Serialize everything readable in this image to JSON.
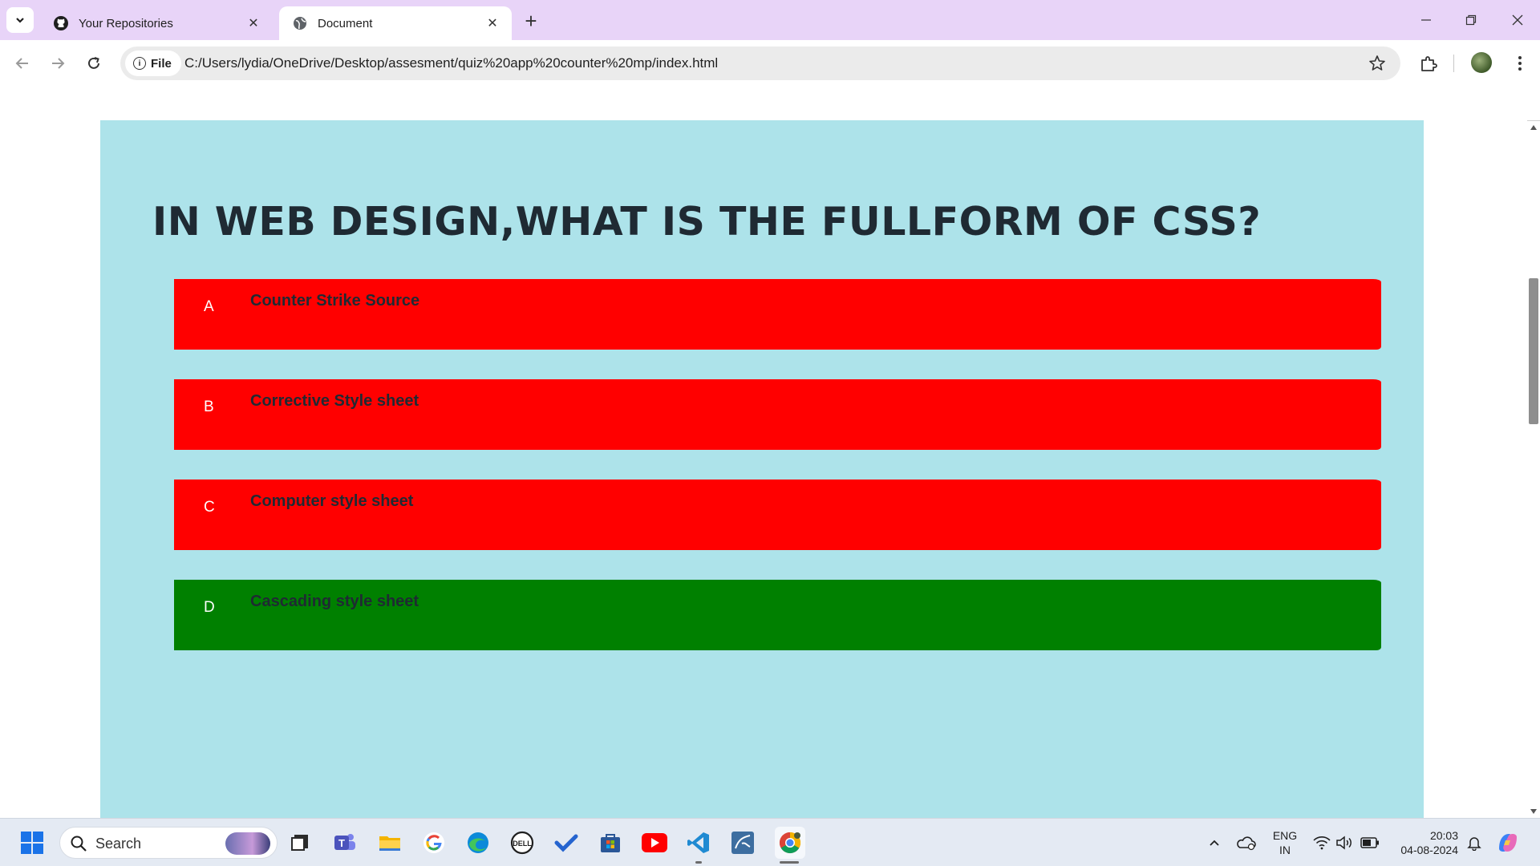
{
  "browser": {
    "tabs": [
      {
        "title": "Your Repositories",
        "active": false,
        "favicon": "github-icon"
      },
      {
        "title": "Document",
        "active": true,
        "favicon": "globe-icon"
      }
    ],
    "address": {
      "scheme_chip": "File",
      "url": "C:/Users/lydia/OneDrive/Desktop/assesment/quiz%20app%20counter%20mp/index.html"
    }
  },
  "quiz": {
    "question": "IN WEB DESIGN,WHAT IS THE FULLFORM OF CSS?",
    "answers": [
      {
        "letter": "A",
        "text": "Counter Strike Source",
        "status": "wrong",
        "color": "#ff0000"
      },
      {
        "letter": "B",
        "text": "Corrective Style sheet",
        "status": "wrong",
        "color": "#ff0000"
      },
      {
        "letter": "C",
        "text": "Computer style sheet",
        "status": "wrong",
        "color": "#ff0000"
      },
      {
        "letter": "D",
        "text": "Cascading style sheet",
        "status": "correct",
        "color": "#008000"
      }
    ],
    "background_color": "#ade3ea"
  },
  "taskbar": {
    "search_placeholder": "Search",
    "pinned_apps": [
      "start-icon",
      "task-view-icon",
      "teams-icon",
      "file-explorer-icon",
      "google-icon",
      "edge-icon",
      "dell-icon",
      "todo-icon",
      "store-icon",
      "youtube-icon",
      "vscode-icon",
      "mysql-workbench-icon",
      "chrome-icon"
    ],
    "tray": {
      "language_top": "ENG",
      "language_bottom": "IN",
      "time": "20:03",
      "date": "04-08-2024"
    }
  },
  "colors": {
    "tabstrip": "#e8d4f8",
    "wrong": "#ff0000",
    "correct": "#008000"
  }
}
